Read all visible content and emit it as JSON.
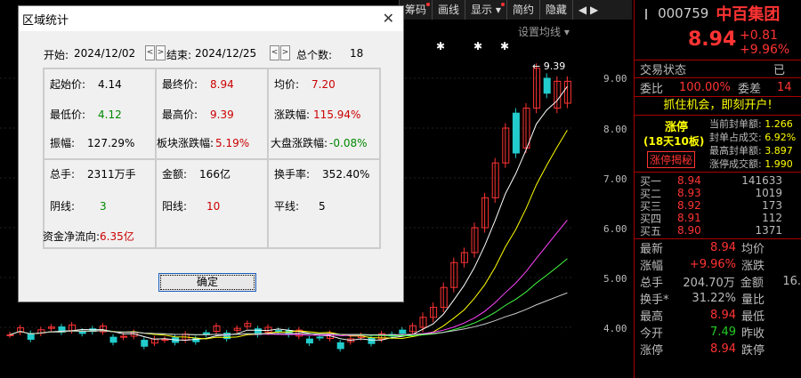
{
  "toolbar": {
    "items": [
      {
        "label": "筹码",
        "dot": true
      },
      {
        "label": "画线",
        "dot": false
      },
      {
        "label": "显示 ▾",
        "dot": true
      },
      {
        "label": "简约",
        "dot": false
      },
      {
        "label": "隐藏",
        "dot": false
      },
      {
        "label": "◀ ▶",
        "dot": false
      }
    ]
  },
  "chart": {
    "ma_setting_label": "设置均线 ▾",
    "price_ticks": [
      "9.00",
      "8.00",
      "7.00",
      "6.00",
      "5.00",
      "4.00"
    ],
    "high_marker": "9.39"
  },
  "dialog": {
    "title": "区域统计",
    "start_label": "开始:",
    "start_date": "2024/12/02",
    "end_label": "结束:",
    "end_date": "2024/12/25",
    "count_label": "总个数:",
    "count_value": "18",
    "stats": {
      "start_price": {
        "label": "起始价:",
        "value": "4.14"
      },
      "end_price": {
        "label": "最终价:",
        "value": "8.94"
      },
      "avg_price": {
        "label": "均价:",
        "value": "7.20"
      },
      "low_price": {
        "label": "最低价:",
        "value": "4.12"
      },
      "high_price": {
        "label": "最高价:",
        "value": "9.39"
      },
      "pct_change": {
        "label": "涨跌幅:",
        "value": "115.94%"
      },
      "amplitude": {
        "label": "振幅:",
        "value": "127.29%"
      },
      "sector_change": {
        "label": "板块涨跌幅:",
        "value": "5.19%"
      },
      "market_change": {
        "label": "大盘涨跌幅:",
        "value": "-0.08%"
      },
      "volume": {
        "label": "总手:",
        "value": "2311万手"
      },
      "amount": {
        "label": "金额:",
        "value": "166亿"
      },
      "turnover": {
        "label": "换手率:",
        "value": "352.40%"
      },
      "down_count": {
        "label": "阴线:",
        "value": "3"
      },
      "up_count": {
        "label": "阳线:",
        "value": "10"
      },
      "flat_count": {
        "label": "平线:",
        "value": "5"
      },
      "net_inflow": {
        "label": "资金净流向:",
        "value": "6.35亿"
      }
    },
    "ok_label": "确定"
  },
  "panel": {
    "code": "000759",
    "name": "中百集团",
    "price": "8.94",
    "change": "+0.81",
    "change_pct": "+9.96%",
    "status_label": "交易状态",
    "status_value": "已",
    "weibi_label": "委比",
    "weibi_value": "100.00%",
    "weicha_label": "委差",
    "weicha_value": "14",
    "promo": "抓住机会，即刻开户!",
    "limit_title": "涨停",
    "limit_sub": "(18天10板)",
    "limit_btn": "涨停揭秘",
    "limit_info": [
      {
        "label": "当前封单额:",
        "value": "1.266"
      },
      {
        "label": "封单占成交:",
        "value": "6.92%"
      },
      {
        "label": "最高封单额:",
        "value": "3.897"
      },
      {
        "label": "涨停成交额:",
        "value": "1.990"
      }
    ],
    "bids": [
      {
        "label": "买一",
        "price": "8.94",
        "vol": "141633"
      },
      {
        "label": "买二",
        "price": "8.93",
        "vol": "1019"
      },
      {
        "label": "买三",
        "price": "8.92",
        "vol": "173"
      },
      {
        "label": "买四",
        "price": "8.91",
        "vol": "112"
      },
      {
        "label": "买五",
        "price": "8.90",
        "vol": "1371"
      }
    ],
    "latest_label": "最新",
    "latest_value": "8.94",
    "avg_label": "均价",
    "chgpct_label": "涨幅",
    "chgpct_value": "+9.96%",
    "updown_label": "涨跌",
    "updown_value": "",
    "total_label": "总手",
    "total_value": "204.70万",
    "amount_label": "金额",
    "amount_value": "16.",
    "turnover_label": "换手*",
    "turnover_value": "31.22%",
    "volratio_label": "量比",
    "high_label": "最高",
    "high_value": "8.94",
    "low_label": "最低",
    "open_label": "今开",
    "open_value": "7.49",
    "prev_label": "昨收",
    "limitup_label": "涨停",
    "limitup_value": "8.94",
    "limitdown_label": "跌停"
  },
  "colors": {
    "up": "#ff3333",
    "down": "#22cccc",
    "ma5": "#ffffff",
    "ma10": "#ffff00",
    "ma20": "#ff44ff",
    "ma30": "#44ff44",
    "ma60": "#cccccc"
  }
}
